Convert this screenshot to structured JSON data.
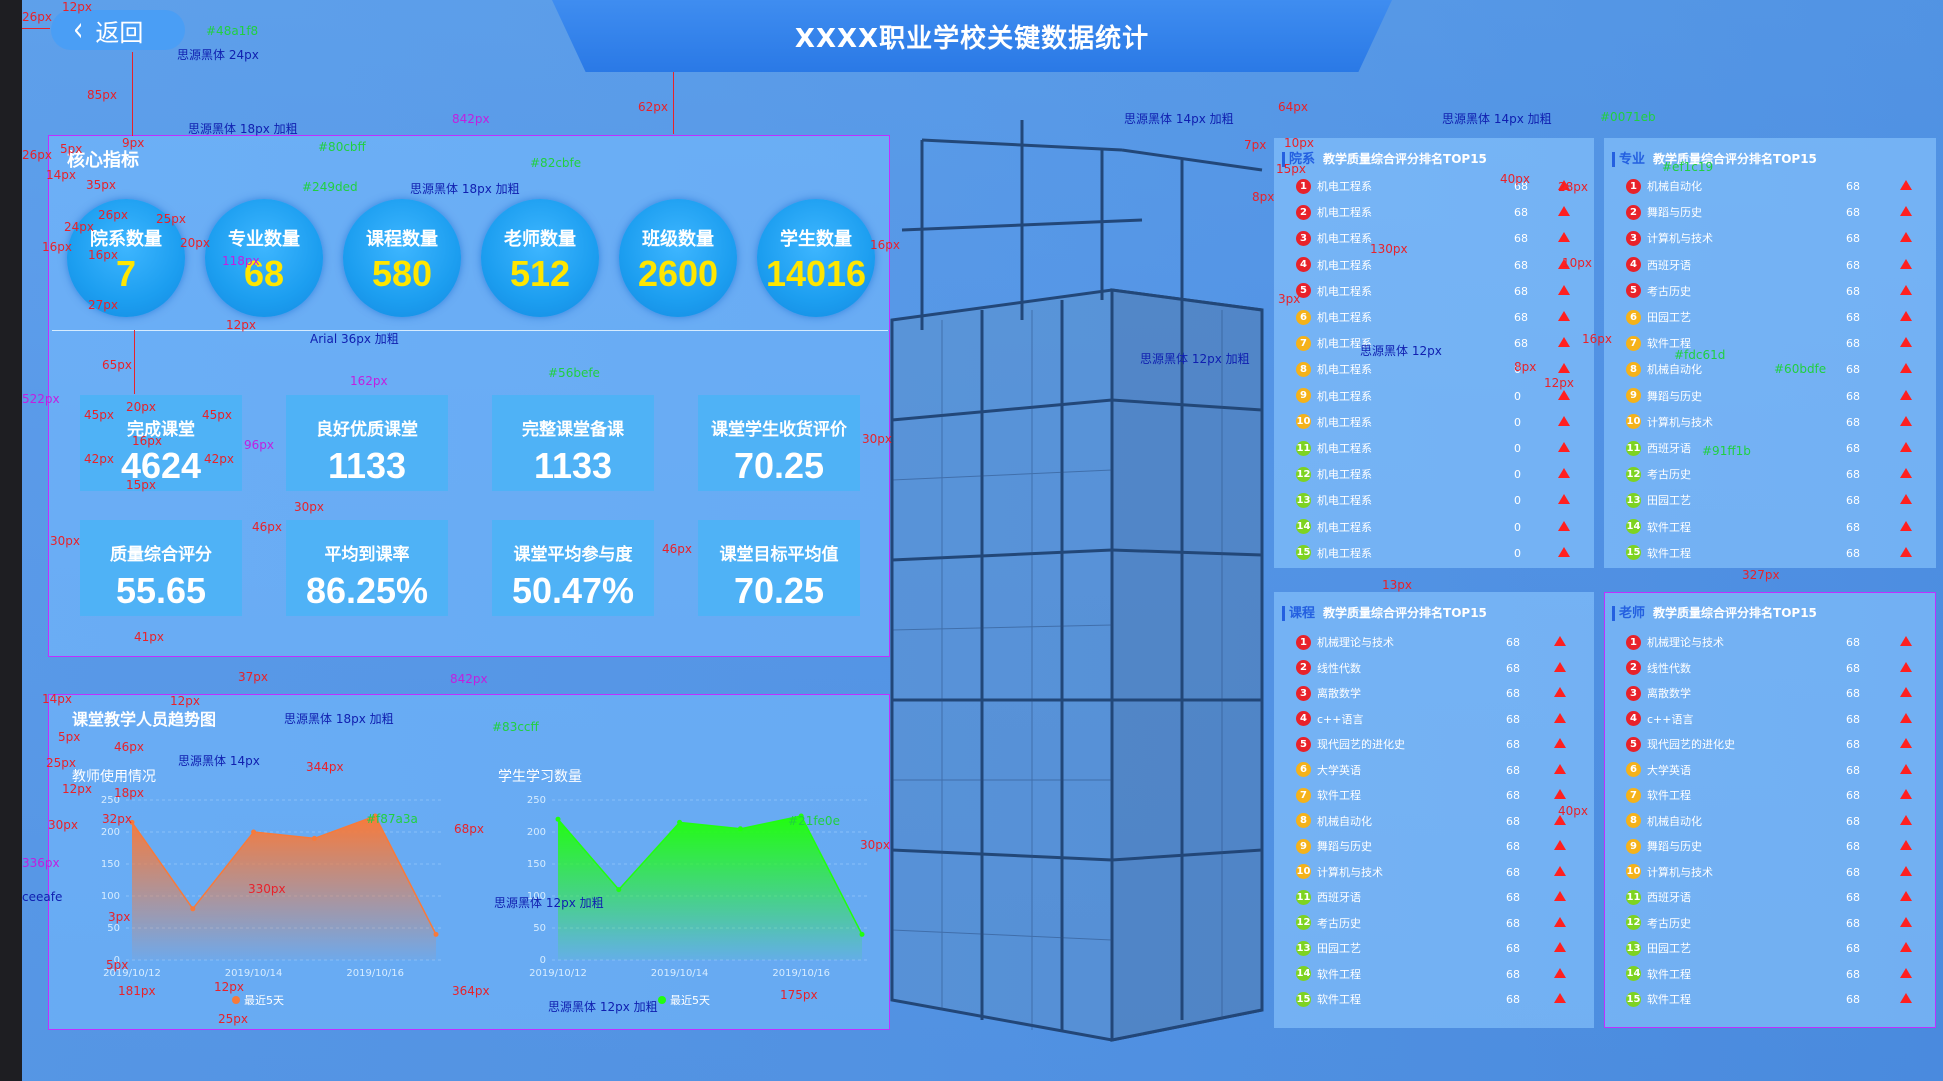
{
  "back_label": "返回",
  "title": "XXXX职业学校关键数据统计",
  "core": {
    "title": "核心指标",
    "circles": [
      {
        "label": "院系数量",
        "value": "7"
      },
      {
        "label": "专业数量",
        "value": "68"
      },
      {
        "label": "课程数量",
        "value": "580"
      },
      {
        "label": "老师数量",
        "value": "512"
      },
      {
        "label": "班级数量",
        "value": "2600"
      },
      {
        "label": "学生数量",
        "value": "14016"
      }
    ],
    "cards": [
      {
        "label": "完成课堂",
        "value": "4624"
      },
      {
        "label": "良好优质课堂",
        "value": "1133"
      },
      {
        "label": "完整课堂备课",
        "value": "1133"
      },
      {
        "label": "课堂学生收货评价",
        "value": "70.25"
      },
      {
        "label": "质量综合评分",
        "value": "55.65"
      },
      {
        "label": "平均到课率",
        "value": "86.25%"
      },
      {
        "label": "课堂平均参与度",
        "value": "50.47%"
      },
      {
        "label": "课堂目标平均值",
        "value": "70.25"
      }
    ]
  },
  "trend": {
    "title": "课堂教学人员趋势图",
    "legend": "最近5天"
  },
  "chart_data": [
    {
      "type": "area",
      "title": "教师使用情况",
      "x": [
        "2019/10/12",
        "",
        "2019/10/14",
        "",
        "2019/10/16",
        ""
      ],
      "series": [
        {
          "values": [
            215,
            80,
            200,
            190,
            225,
            40
          ]
        }
      ],
      "ylim": [
        0,
        250
      ],
      "yticks": [
        0,
        50,
        100,
        150,
        200,
        250
      ],
      "color": "#f87a3a",
      "legend": "最近5天"
    },
    {
      "type": "area",
      "title": "学生学习数量",
      "x": [
        "2019/10/12",
        "",
        "2019/10/14",
        "",
        "2019/10/16",
        ""
      ],
      "series": [
        {
          "values": [
            220,
            110,
            215,
            205,
            225,
            40
          ]
        }
      ],
      "ylim": [
        0,
        250
      ],
      "yticks": [
        0,
        50,
        100,
        150,
        200,
        250
      ],
      "color": "#21fe0e",
      "legend": "最近5天"
    }
  ],
  "rank_dept": {
    "tag": "院系",
    "title": "教学质量综合评分排名TOP15",
    "rows": [
      {
        "name": "机电工程系",
        "value": "68"
      },
      {
        "name": "机电工程系",
        "value": "68"
      },
      {
        "name": "机电工程系",
        "value": "68"
      },
      {
        "name": "机电工程系",
        "value": "68"
      },
      {
        "name": "机电工程系",
        "value": "68"
      },
      {
        "name": "机电工程系",
        "value": "68"
      },
      {
        "name": "机电工程系",
        "value": "68"
      },
      {
        "name": "机电工程系",
        "value": "0"
      },
      {
        "name": "机电工程系",
        "value": "0"
      },
      {
        "name": "机电工程系",
        "value": "0"
      },
      {
        "name": "机电工程系",
        "value": "0"
      },
      {
        "name": "机电工程系",
        "value": "0"
      },
      {
        "name": "机电工程系",
        "value": "0"
      },
      {
        "name": "机电工程系",
        "value": "0"
      },
      {
        "name": "机电工程系",
        "value": "0"
      }
    ]
  },
  "rank_major": {
    "tag": "专业",
    "title": "教学质量综合评分排名TOP15",
    "rows": [
      {
        "name": "机械自动化",
        "value": "68"
      },
      {
        "name": "舞蹈与历史",
        "value": "68"
      },
      {
        "name": "计算机与技术",
        "value": "68"
      },
      {
        "name": "西班牙语",
        "value": "68"
      },
      {
        "name": "考古历史",
        "value": "68"
      },
      {
        "name": "田园工艺",
        "value": "68"
      },
      {
        "name": "软件工程",
        "value": "68"
      },
      {
        "name": "机械自动化",
        "value": "68"
      },
      {
        "name": "舞蹈与历史",
        "value": "68"
      },
      {
        "name": "计算机与技术",
        "value": "68"
      },
      {
        "name": "西班牙语",
        "value": "68"
      },
      {
        "name": "考古历史",
        "value": "68"
      },
      {
        "name": "田园工艺",
        "value": "68"
      },
      {
        "name": "软件工程",
        "value": "68"
      },
      {
        "name": "软件工程",
        "value": "68"
      }
    ]
  },
  "rank_course": {
    "tag": "课程",
    "title": "教学质量综合评分排名TOP15",
    "rows": [
      {
        "name": "机械理论与技术",
        "value": "68"
      },
      {
        "name": "线性代数",
        "value": "68"
      },
      {
        "name": "离散数学",
        "value": "68"
      },
      {
        "name": "c++语言",
        "value": "68"
      },
      {
        "name": "现代园艺的进化史",
        "value": "68"
      },
      {
        "name": "大学英语",
        "value": "68"
      },
      {
        "name": "软件工程",
        "value": "68"
      },
      {
        "name": "机械自动化",
        "value": "68"
      },
      {
        "name": "舞蹈与历史",
        "value": "68"
      },
      {
        "name": "计算机与技术",
        "value": "68"
      },
      {
        "name": "西班牙语",
        "value": "68"
      },
      {
        "name": "考古历史",
        "value": "68"
      },
      {
        "name": "田园工艺",
        "value": "68"
      },
      {
        "name": "软件工程",
        "value": "68"
      },
      {
        "name": "软件工程",
        "value": "68"
      }
    ]
  },
  "rank_teacher": {
    "tag": "老师",
    "title": "教学质量综合评分排名TOP15",
    "rows": [
      {
        "name": "机械理论与技术",
        "value": "68"
      },
      {
        "name": "线性代数",
        "value": "68"
      },
      {
        "name": "离散数学",
        "value": "68"
      },
      {
        "name": "c++语言",
        "value": "68"
      },
      {
        "name": "现代园艺的进化史",
        "value": "68"
      },
      {
        "name": "大学英语",
        "value": "68"
      },
      {
        "name": "软件工程",
        "value": "68"
      },
      {
        "name": "机械自动化",
        "value": "68"
      },
      {
        "name": "舞蹈与历史",
        "value": "68"
      },
      {
        "name": "计算机与技术",
        "value": "68"
      },
      {
        "name": "西班牙语",
        "value": "68"
      },
      {
        "name": "考古历史",
        "value": "68"
      },
      {
        "name": "田园工艺",
        "value": "68"
      },
      {
        "name": "软件工程",
        "value": "68"
      },
      {
        "name": "软件工程",
        "value": "68"
      }
    ]
  },
  "rank_colors": [
    "#e8222a",
    "#e8222a",
    "#e8222a",
    "#e8222a",
    "#e8222a",
    "#f5b21a",
    "#f5b21a",
    "#f5b21a",
    "#f5b21a",
    "#f5b21a",
    "#7ed321",
    "#7ed321",
    "#7ed321",
    "#7ed321",
    "#7ed321"
  ],
  "annotations": {
    "a26": "26px",
    "a12": "12px",
    "c48a1f8": "#48a1f8",
    "font24": "思源黑体 24px",
    "a85": "85px",
    "a9": "9px",
    "font18b": "思源黑体 18px 加粗",
    "a842": "842px",
    "a62": "62px",
    "a5": "5px",
    "c80cbff": "#80cbff",
    "a14": "14px",
    "c82cbfe": "#82cbfe",
    "a35": "35px",
    "c249ded": "#249ded",
    "font18b2": "思源黑体 18px 加粗",
    "a26b": "26px",
    "a25": "25px",
    "a24": "24px",
    "a16": "16px",
    "a20": "20px",
    "a16b": "16px",
    "a118": "118px",
    "a27": "27px",
    "a12b": "12px",
    "arial36": "Arial 36px 加粗",
    "a65": "65px",
    "a162": "162px",
    "c56befe": "#56befe",
    "a45": "45px",
    "a20b": "20px",
    "a45b": "45px",
    "a16c": "16px",
    "a42": "42px",
    "a42b": "42px",
    "a15": "15px",
    "a96": "96px",
    "a30": "30px",
    "a522": "522px",
    "a30b": "30px",
    "a46": "46px",
    "a46b": "46px",
    "a41": "41px",
    "a37": "37px",
    "a842b": "842px",
    "a14b": "14px",
    "a12c": "12px",
    "font18b3": "思源黑体 18px 加粗",
    "c83ccff": "#83ccff",
    "a5b": "5px",
    "a46c": "46px",
    "font14": "思源黑体 14px",
    "a25b": "25px",
    "a344": "344px",
    "a12d": "12px",
    "a18": "18px",
    "a32": "32px",
    "cf87a3a": "#f87a3a",
    "a30c": "30px",
    "a68": "68px",
    "c21fe0e": "#21fe0e",
    "a336": "336px",
    "ceeafe": "ceeafe",
    "a330": "330px",
    "a3": "3px",
    "font12b": "思源黑体 12px 加粗",
    "a30d": "30px",
    "a5c": "5px",
    "a181": "181px",
    "a12e": "12px",
    "a364": "364px",
    "a175": "175px",
    "a25c": "25px",
    "font12b2": "思源黑体 12px 加粗",
    "font14b": "思源黑体 14px 加粗",
    "font14b2": "思源黑体 14px 加粗",
    "c0071eb": "#0071eb",
    "a64": "64px",
    "a7": "7px",
    "a10": "10px",
    "a15b": "15px",
    "a8": "8px",
    "a40": "40px",
    "a28": "28px",
    "cf1c19": "#ef1c19",
    "a130": "130px",
    "a3b": "3px",
    "a10b": "10px",
    "font12b3": "思源黑体 12px 加粗",
    "font12": "思源黑体 12px",
    "a16d": "16px",
    "cdc61d": "#fdc61d",
    "c60bdfe": "#60bdfe",
    "a8b": "8px",
    "a12f": "12px",
    "c91f1b": "#91ff1b",
    "a13": "13px",
    "a327": "327px",
    "a40b": "40px"
  }
}
